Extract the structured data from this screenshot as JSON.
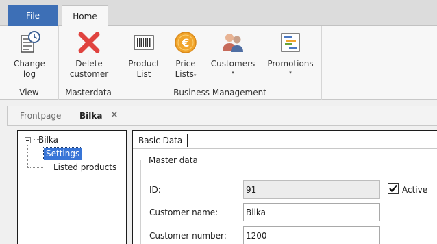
{
  "ribbon_tabs": {
    "file": "File",
    "home": "Home"
  },
  "groups": {
    "view": {
      "label": "View",
      "buttons": [
        {
          "line1": "Change",
          "line2": "log",
          "icon": "change-log-icon"
        }
      ]
    },
    "masterdata": {
      "label": "Masterdata",
      "buttons": [
        {
          "line1": "Delete",
          "line2": "customer",
          "icon": "delete-x-icon"
        }
      ]
    },
    "business_management": {
      "label": "Business Management",
      "buttons": [
        {
          "line1": "Product",
          "line2": "List",
          "icon": "barcode-icon"
        },
        {
          "line1": "Price",
          "line2": "Lists",
          "icon": "euro-coin-icon",
          "has_dropdown": true
        },
        {
          "line1": "Customers",
          "icon": "people-icon",
          "has_dropdown": true
        },
        {
          "line1": "Promotions",
          "icon": "gantt-chart-icon",
          "has_dropdown": true
        }
      ]
    }
  },
  "doc_tabs": [
    {
      "label": "Frontpage",
      "active": false
    },
    {
      "label": "Bilka",
      "active": true,
      "closable": true
    }
  ],
  "tree": {
    "root": "Bilka",
    "children": [
      {
        "label": "Settings",
        "selected": true
      },
      {
        "label": "Listed products",
        "selected": false
      }
    ]
  },
  "detail": {
    "sub_tab": "Basic Data",
    "section_title": "Master data",
    "fields": [
      {
        "label": "ID:",
        "value": "91",
        "readonly": true
      },
      {
        "label": "Customer name:",
        "value": "Bilka",
        "readonly": false
      },
      {
        "label": "Customer number:",
        "value": "1200",
        "readonly": false
      }
    ],
    "active_checkbox": {
      "label": "Active",
      "checked": true
    }
  },
  "colors": {
    "file_tab": "#3d6fb6",
    "selection": "#3875d7",
    "delete_red": "#e0433f",
    "coin_orange": "#f1a52c"
  },
  "glyphs": {
    "dropdown": "▾",
    "close": "✕",
    "check": "✔"
  }
}
